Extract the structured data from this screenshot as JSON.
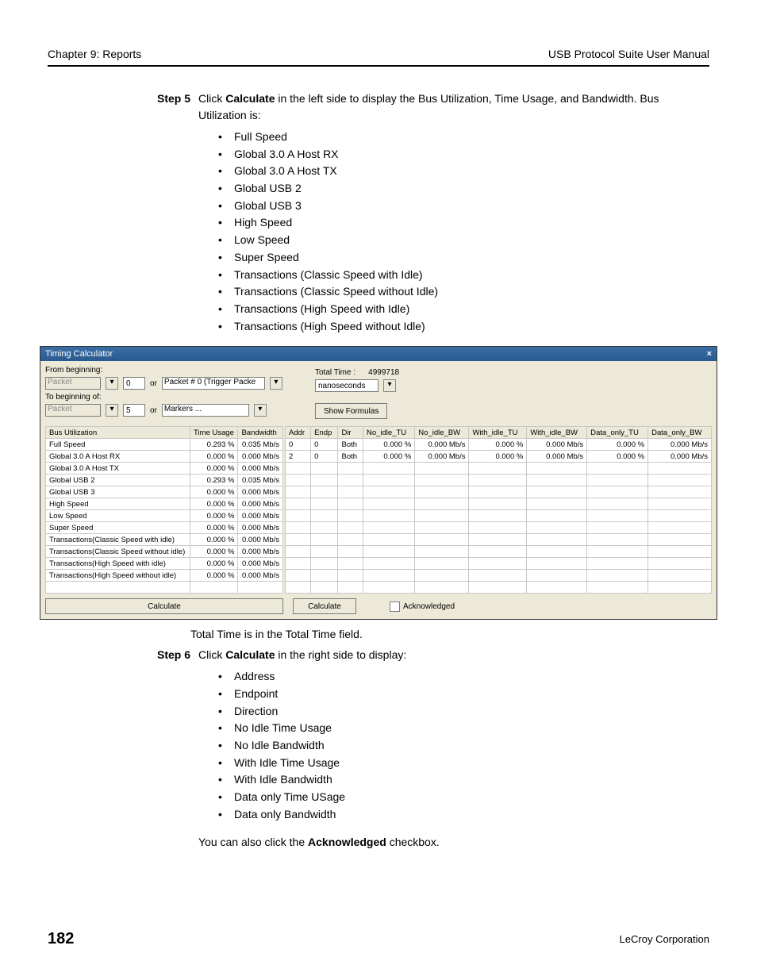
{
  "header": {
    "left": "Chapter 9: Reports",
    "right": "USB Protocol Suite User Manual"
  },
  "step5": {
    "label": "Step 5",
    "pre": "Click ",
    "bold": "Calculate",
    "post": " in the left side to display the Bus Utilization, Time Usage, and Bandwidth. Bus Utilization is:",
    "items": [
      "Full Speed",
      "Global 3.0 A Host RX",
      "Global 3.0 A Host TX",
      "Global USB 2",
      "Global USB 3",
      "High Speed",
      "Low Speed",
      "Super Speed",
      "Transactions (Classic Speed with Idle)",
      "Transactions (Classic Speed without Idle)",
      "Transactions (High Speed with Idle)",
      "Transactions (High Speed without Idle)"
    ]
  },
  "totaltime_note": "Total Time is in the Total Time field.",
  "step6": {
    "label": "Step 6",
    "pre": "Click ",
    "bold": "Calculate",
    "post": " in the right side to display:",
    "items": [
      "Address",
      "Endpoint",
      "Direction",
      "No Idle Time Usage",
      "No Idle Bandwidth",
      "With Idle Time Usage",
      "With Idle Bandwidth",
      "Data only Time USage",
      "Data only Bandwidth"
    ]
  },
  "ack_line": {
    "pre": "You can also click the ",
    "bold": "Acknowledged",
    "post": " checkbox."
  },
  "footer": {
    "page": "182",
    "corp": "LeCroy Corporation"
  },
  "tc": {
    "title": "Timing Calculator",
    "from": "From beginning:",
    "to": "To beginning of:",
    "or": "or",
    "packet": "Packet",
    "packet_trig": "Packet # 0 (Trigger Packe",
    "markers": "Markers ...",
    "val0": "0",
    "val5": "5",
    "totaltime_lbl": "Total Time :",
    "totaltime_val": "4999718",
    "ns": "nanoseconds",
    "showf": "Show Formulas",
    "calc": "Calculate",
    "ack": "Acknowledged",
    "left": {
      "cols": [
        "Bus Utilization",
        "Time Usage",
        "Bandwidth"
      ],
      "rows": [
        [
          "Full Speed",
          "0.293 %",
          "0.035 Mb/s"
        ],
        [
          "Global 3.0 A Host RX",
          "0.000 %",
          "0.000 Mb/s"
        ],
        [
          "Global 3.0 A Host TX",
          "0.000 %",
          "0.000 Mb/s"
        ],
        [
          "Global USB 2",
          "0.293 %",
          "0.035 Mb/s"
        ],
        [
          "Global USB 3",
          "0.000 %",
          "0.000 Mb/s"
        ],
        [
          "High Speed",
          "0.000 %",
          "0.000 Mb/s"
        ],
        [
          "Low Speed",
          "0.000 %",
          "0.000 Mb/s"
        ],
        [
          "Super Speed",
          "0.000 %",
          "0.000 Mb/s"
        ],
        [
          "Transactions(Classic Speed with idle)",
          "0.000 %",
          "0.000 Mb/s"
        ],
        [
          "Transactions(Classic Speed without idle)",
          "0.000 %",
          "0.000 Mb/s"
        ],
        [
          "Transactions(High Speed with idle)",
          "0.000 %",
          "0.000 Mb/s"
        ],
        [
          "Transactions(High Speed without idle)",
          "0.000 %",
          "0.000 Mb/s"
        ]
      ]
    },
    "right": {
      "cols": [
        "Addr",
        "Endp",
        "Dir",
        "No_idle_TU",
        "No_idle_BW",
        "With_idle_TU",
        "With_idle_BW",
        "Data_only_TU",
        "Data_only_BW"
      ],
      "rows": [
        [
          "0",
          "0",
          "Both",
          "0.000 %",
          "0.000 Mb/s",
          "0.000 %",
          "0.000 Mb/s",
          "0.000 %",
          "0.000 Mb/s"
        ],
        [
          "2",
          "0",
          "Both",
          "0.000 %",
          "0.000 Mb/s",
          "0.000 %",
          "0.000 Mb/s",
          "0.000 %",
          "0.000 Mb/s"
        ]
      ],
      "empty_rows": 11
    }
  }
}
